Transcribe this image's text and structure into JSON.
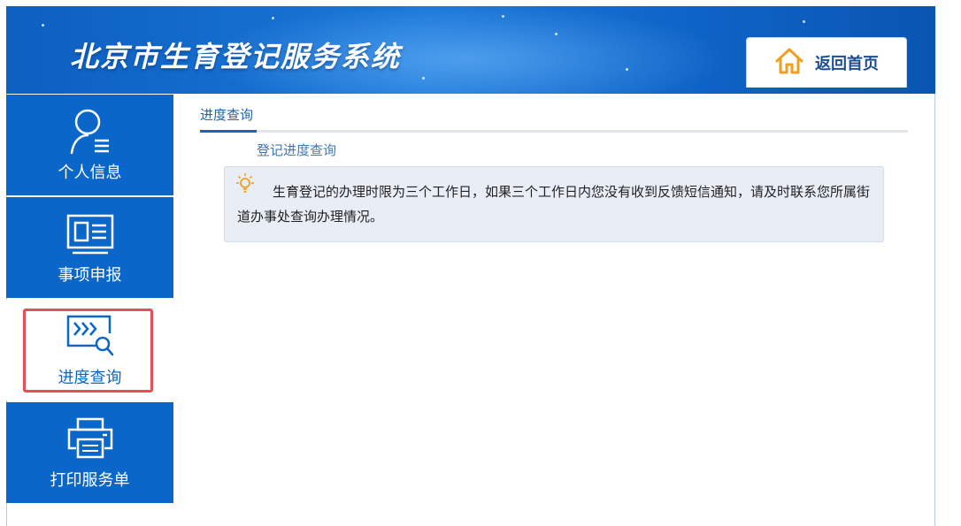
{
  "header": {
    "title": "北京市生育登记服务系统",
    "home_button": "返回首页"
  },
  "sidebar": {
    "items": [
      {
        "label": "个人信息",
        "icon": "user-icon",
        "active": false
      },
      {
        "label": "事项申报",
        "icon": "id-card-icon",
        "active": false
      },
      {
        "label": "进度查询",
        "icon": "progress-search-icon",
        "active": true
      },
      {
        "label": "打印服务单",
        "icon": "printer-icon",
        "active": false
      }
    ]
  },
  "main": {
    "tab_label": "进度查询",
    "subtitle": "登记进度查询",
    "notice": "生育登记的办理时限为三个工作日，如果三个工作日内您没有收到反馈短信通知，请及时联系您所属街道办事处查询办理情况。"
  },
  "colors": {
    "brand_blue": "#0a66c8",
    "header_blue": "#1a78d8",
    "highlight_red": "#e64f57",
    "home_icon_orange": "#f0a020",
    "bulb_orange": "#f0a020"
  }
}
